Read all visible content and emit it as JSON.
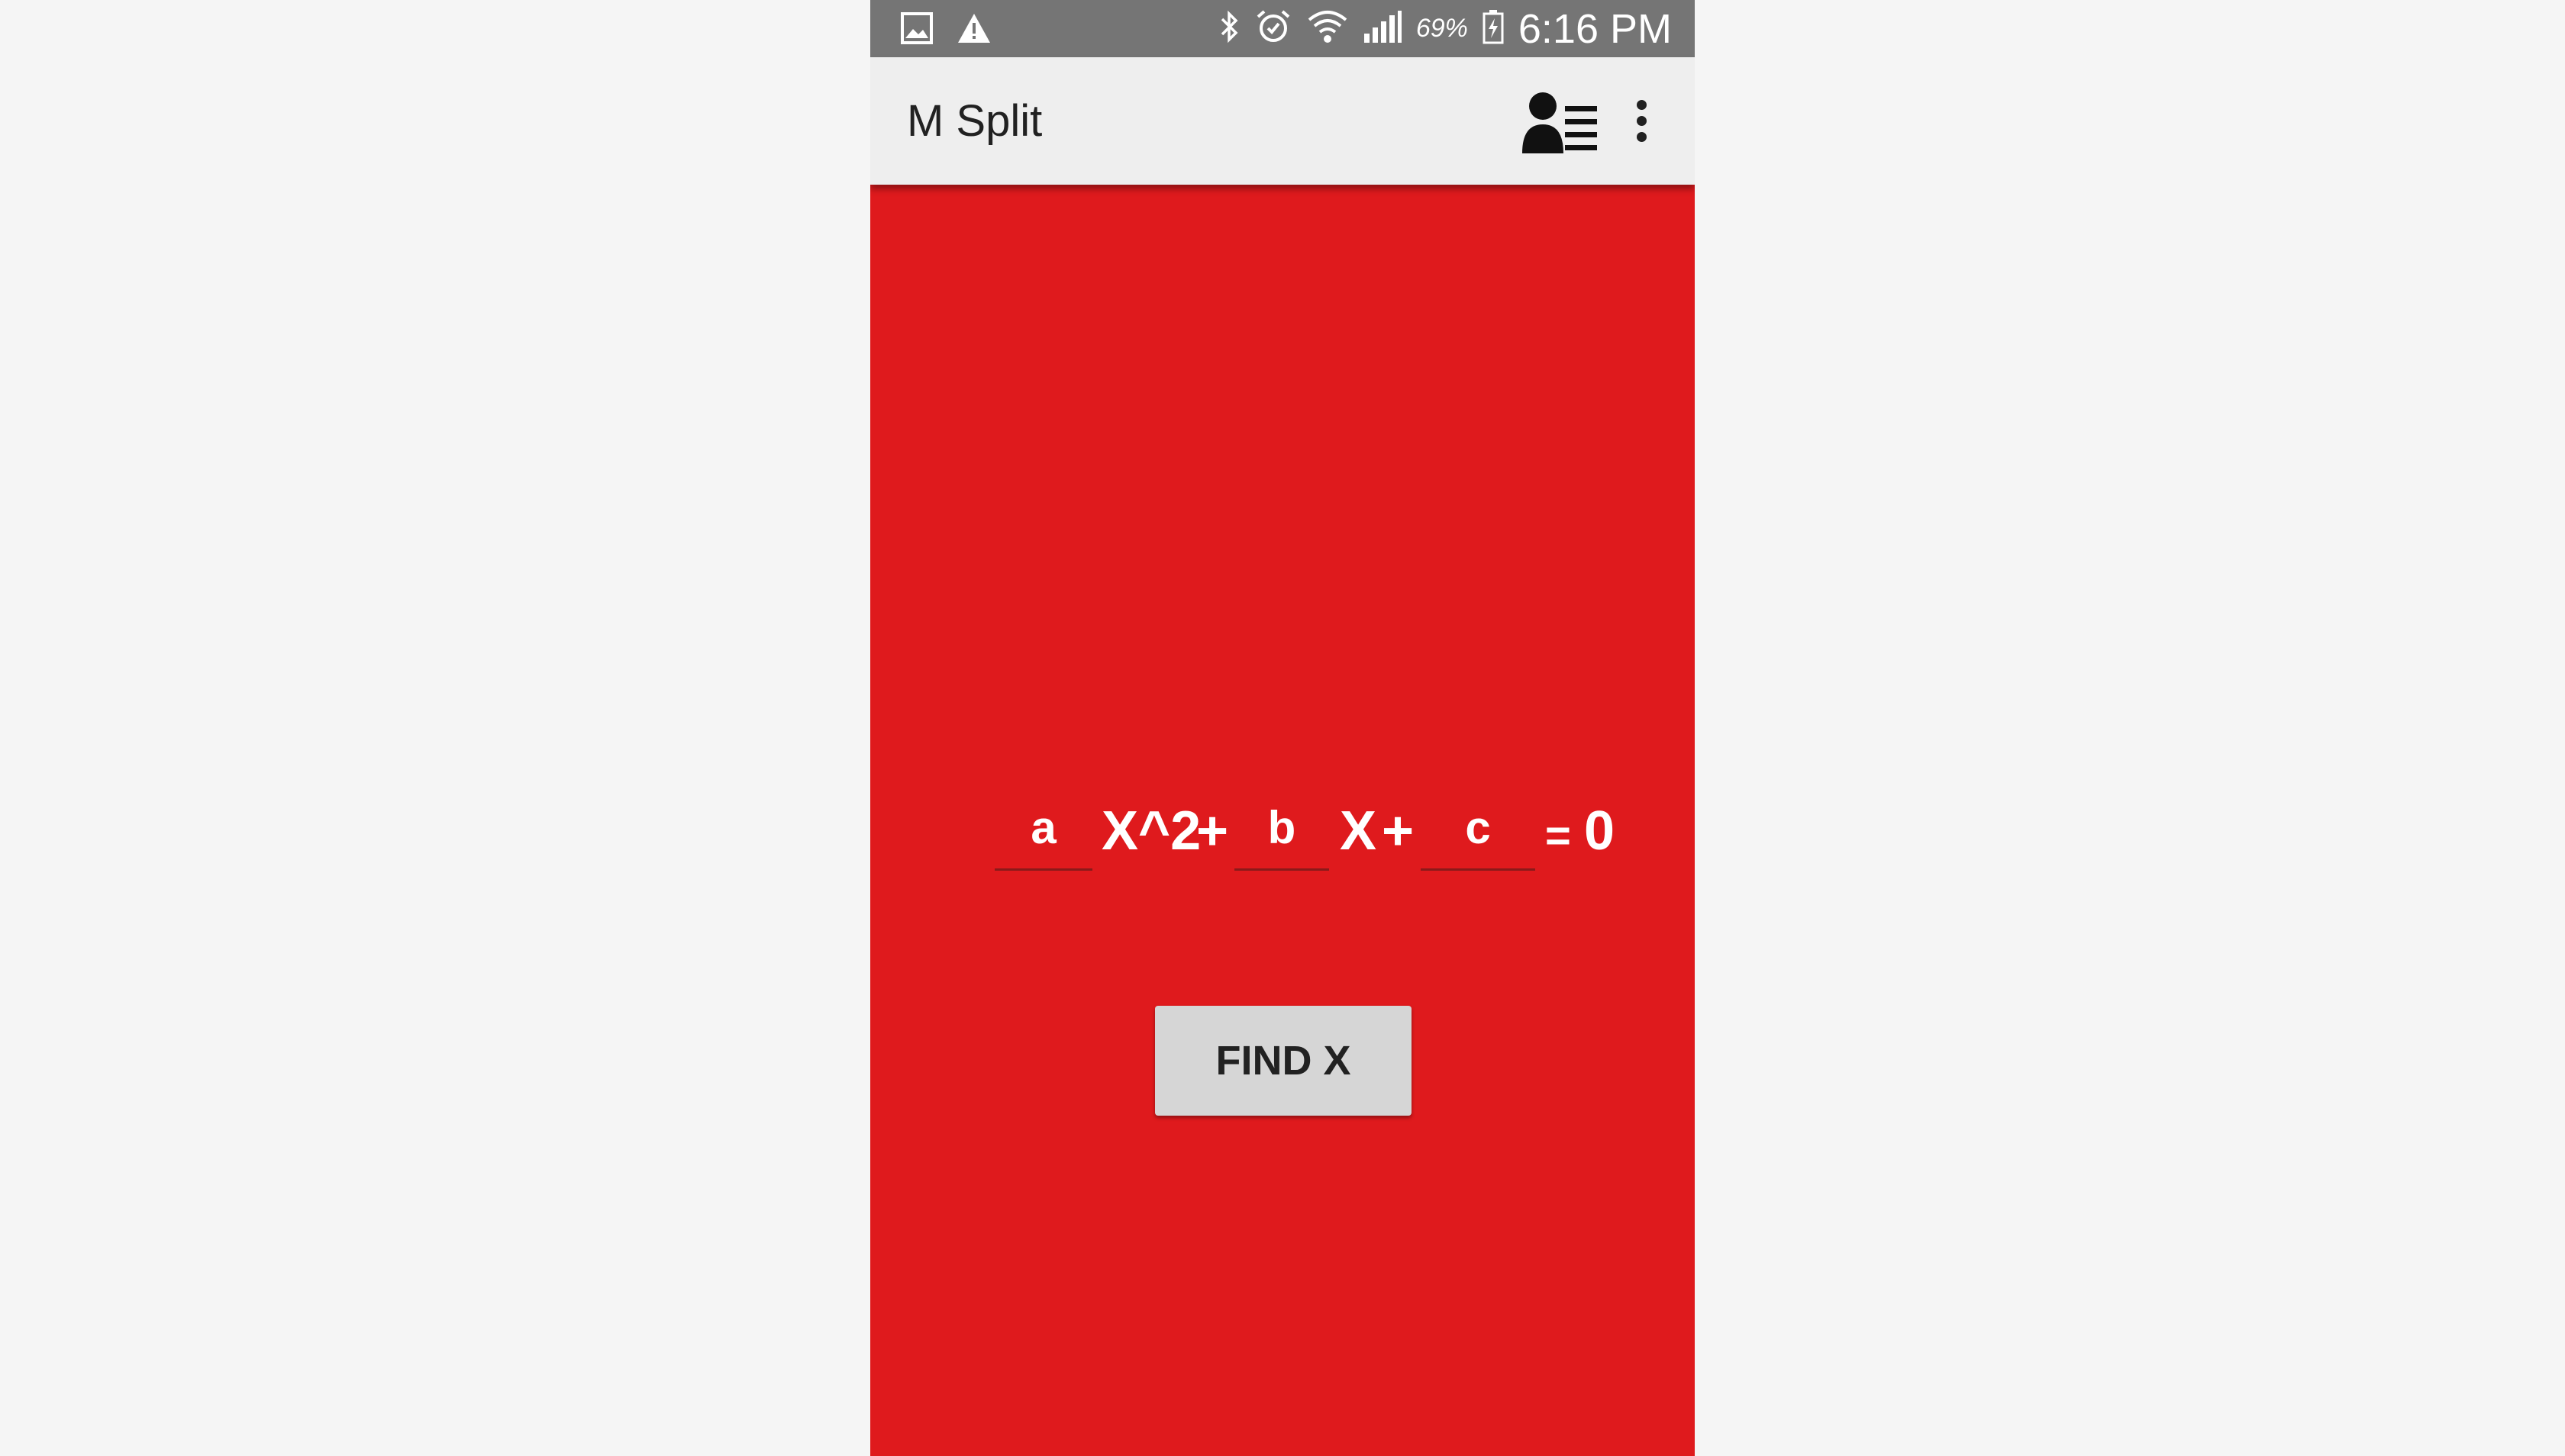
{
  "status_bar": {
    "left_icons": [
      "gallery-icon",
      "warning-icon"
    ],
    "right_icons": [
      "bluetooth-icon",
      "alarm-icon",
      "wifi-icon",
      "signal-icon",
      "battery-charging-icon"
    ],
    "battery_percent": "69%",
    "time": "6:16 PM"
  },
  "app_bar": {
    "title": "M Split",
    "actions": [
      "contacts-list-icon",
      "overflow-menu-icon"
    ]
  },
  "equation": {
    "a_placeholder": "a",
    "x2_label": "X^2",
    "plus_1": "+",
    "b_placeholder": "b",
    "x_label": "X",
    "plus_2": "+",
    "c_placeholder": "c",
    "equals": "=",
    "rhs": "0"
  },
  "find_button": {
    "label": "FIND X"
  },
  "colors": {
    "background": "#df1a1d",
    "status_bar": "#757575",
    "app_bar": "#eeeeee",
    "button": "#d6d6d6",
    "page_outside": "#f5f5f5"
  }
}
